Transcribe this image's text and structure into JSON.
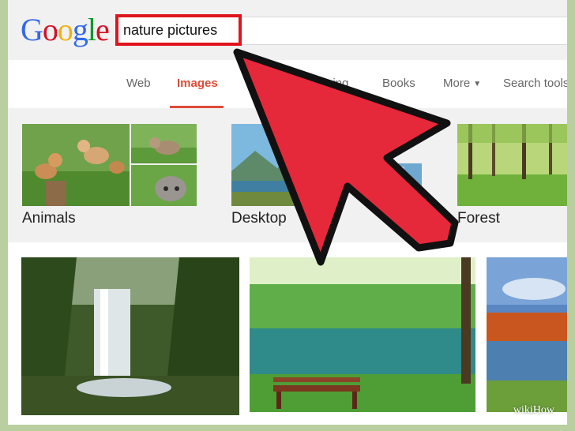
{
  "logo": {
    "letters": [
      "G",
      "o",
      "o",
      "g",
      "l",
      "e"
    ]
  },
  "search": {
    "query": "nature pictures"
  },
  "tabs": [
    {
      "label": "Web"
    },
    {
      "label": "Images"
    },
    {
      "label": "Shopping"
    },
    {
      "label": "Books"
    },
    {
      "label": "More"
    },
    {
      "label": "Search tools"
    }
  ],
  "categories": [
    {
      "label": "Animals"
    },
    {
      "label": "Desktop"
    },
    {
      "label": "Forest"
    }
  ],
  "watermark": {
    "text": "wikiHow"
  },
  "colors": {
    "accent_red": "#dd4b39",
    "highlight_box": "#e0141e",
    "arrow_fill": "#e5283a",
    "logo_blue": "#3369e8",
    "logo_red": "#d50f25",
    "logo_yellow": "#eeb211",
    "logo_green": "#009925"
  },
  "icons": [
    "chevron-down-icon",
    "pointer-arrow-icon"
  ]
}
